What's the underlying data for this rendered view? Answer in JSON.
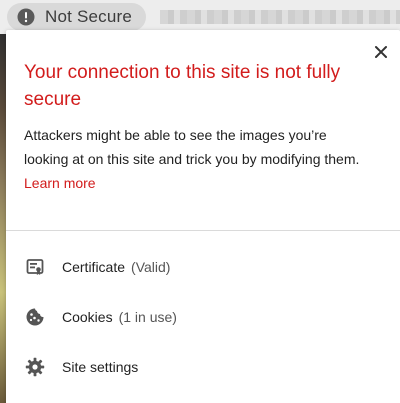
{
  "address_bar": {
    "security_chip_label": "Not Secure"
  },
  "popup": {
    "title": "Your connection to this site is not fully secure",
    "description": "Attackers might be able to see the images you’re looking at on this site and trick you by modifying them.",
    "learn_more_label": "Learn more",
    "close_icon": "close-icon",
    "items": [
      {
        "icon": "certificate-icon",
        "label": "Certificate",
        "detail": "(Valid)"
      },
      {
        "icon": "cookie-icon",
        "label": "Cookies",
        "detail": "(1 in use)"
      },
      {
        "icon": "gear-icon",
        "label": "Site settings",
        "detail": ""
      }
    ]
  },
  "colors": {
    "warning_red": "#d21c1c",
    "chip_background": "#d9d9d9",
    "icon_gray": "#555555"
  }
}
